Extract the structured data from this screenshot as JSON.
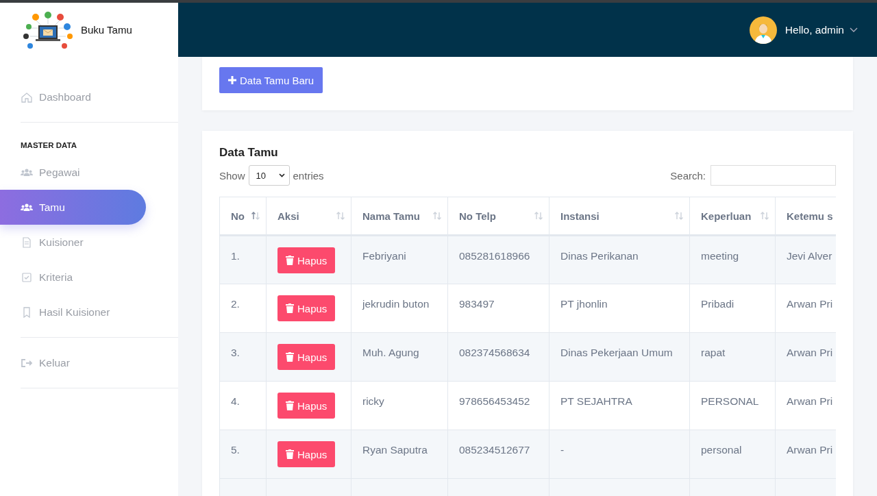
{
  "brand": {
    "title": "Buku Tamu"
  },
  "user": {
    "greeting": "Hello, admin"
  },
  "sidebar": [
    {
      "kind": "link",
      "label": "Dashboard",
      "selected": false
    },
    {
      "kind": "divider"
    },
    {
      "kind": "heading",
      "label": "MASTER DATA"
    },
    {
      "kind": "link",
      "label": "Pegawai",
      "selected": false
    },
    {
      "kind": "link",
      "label": "Tamu",
      "selected": true
    },
    {
      "kind": "link",
      "label": "Kuisioner",
      "selected": false
    },
    {
      "kind": "link",
      "label": "Kriteria",
      "selected": false
    },
    {
      "kind": "link",
      "label": "Hasil Kuisioner",
      "selected": false
    },
    {
      "kind": "divider"
    },
    {
      "kind": "link",
      "label": "Keluar",
      "selected": false
    },
    {
      "kind": "divider"
    }
  ],
  "new_button": "Data Tamu Baru",
  "table_card": {
    "title": "Data Tamu",
    "show_label": "Show",
    "page_size": "10",
    "entries_label": "entries",
    "search_label": "Search:"
  },
  "table": {
    "columns": [
      "No",
      "Aksi",
      "Nama Tamu",
      "No Telp",
      "Instansi",
      "Keperluan",
      "Ketemu s"
    ],
    "rows": [
      {
        "cells": [
          "1.",
          "Hapus",
          "Febriyani",
          "085281618966",
          "Dinas Perikanan",
          "meeting",
          "Jevi Alver"
        ]
      },
      {
        "cells": [
          "2.",
          "Hapus",
          "jekrudin buton",
          "983497",
          "PT jhonlin",
          "Pribadi",
          "Arwan Pri"
        ]
      },
      {
        "cells": [
          "3.",
          "Hapus",
          "Muh. Agung",
          "082374568634",
          "Dinas Pekerjaan Umum",
          "rapat",
          "Arwan Pri"
        ]
      },
      {
        "cells": [
          "4.",
          "Hapus",
          "ricky",
          "978656453452",
          "PT SEJAHTRA",
          "PERSONAL",
          "Arwan Pri"
        ]
      },
      {
        "cells": [
          "5.",
          "Hapus",
          "Ryan Saputra",
          "085234512677",
          "-",
          "personal",
          "Arwan Pri"
        ]
      }
    ]
  }
}
